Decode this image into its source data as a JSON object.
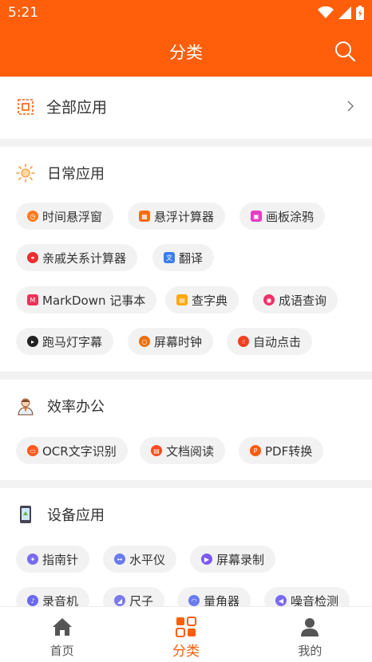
{
  "status": {
    "time": "5:21"
  },
  "appbar": {
    "title": "分类"
  },
  "all_apps": {
    "label": "全部应用"
  },
  "sections": [
    {
      "title": "日常应用",
      "items": [
        "时间悬浮窗",
        "悬浮计算器",
        "画板涂鸦",
        "亲戚关系计算器",
        "翻译",
        "MarkDown 记事本",
        "查字典",
        "成语查询",
        "跑马灯字幕",
        "屏幕时钟",
        "自动点击"
      ]
    },
    {
      "title": "效率办公",
      "items": [
        "OCR文字识别",
        "文档阅读",
        "PDF转换"
      ]
    },
    {
      "title": "设备应用",
      "items": [
        "指南针",
        "水平仪",
        "屏幕录制",
        "录音机",
        "尺子",
        "量角器",
        "噪音检测"
      ]
    }
  ],
  "tabs": [
    {
      "label": "首页"
    },
    {
      "label": "分类"
    },
    {
      "label": "我的"
    }
  ],
  "colors": {
    "accent": "#ff5e0a",
    "chip_bg": "#f2f2f2"
  }
}
